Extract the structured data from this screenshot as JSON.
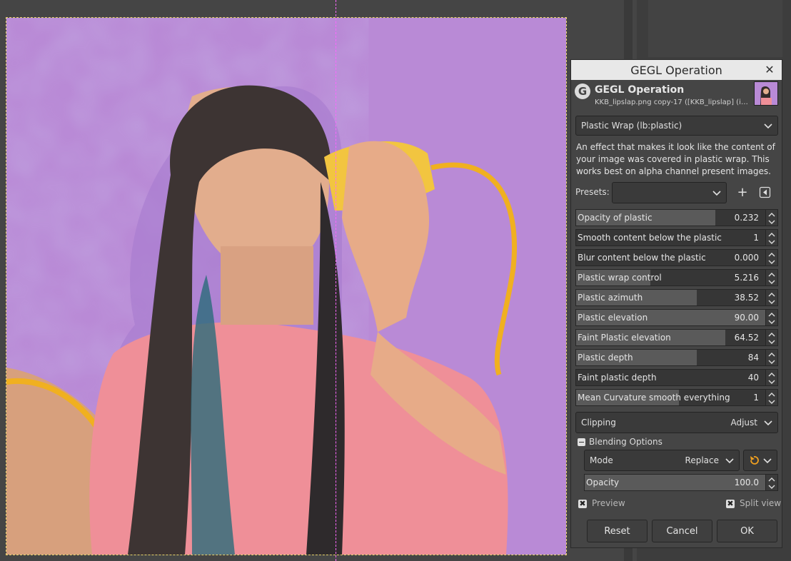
{
  "dialog": {
    "title": "GEGL Operation",
    "header_title": "GEGL Operation",
    "header_subtitle": "KKB_lipslap.png copy-17 ([KKB_lipslap] (imp...",
    "logo_letter": "G",
    "operation": "Plastic Wrap (lb:plastic)",
    "description": "An effect that makes it look like the content of your image was covered in plastic wrap. This works best on alpha channel present images.",
    "presets_label": "Presets:",
    "presets_value": "",
    "add_glyph": "+",
    "params": [
      {
        "label": "Opacity of plastic",
        "value": "0.232",
        "fill": 0.69
      },
      {
        "label": "Smooth content below the plastic",
        "value": "1",
        "fill": 0.0
      },
      {
        "label": "Blur content below the plastic",
        "value": "0.000",
        "fill": 0.0
      },
      {
        "label": "Plastic wrap control",
        "value": "5.216",
        "fill": 0.37
      },
      {
        "label": "Plastic azimuth",
        "value": "38.52",
        "fill": 0.6
      },
      {
        "label": "Plastic elevation",
        "value": "90.00",
        "fill": 1.0
      },
      {
        "label": "Faint Plastic elevation",
        "value": "64.52",
        "fill": 0.74
      },
      {
        "label": "Plastic depth",
        "value": "84",
        "fill": 0.6
      },
      {
        "label": "Faint plastic depth",
        "value": "40",
        "fill": 0.0
      },
      {
        "label": "Mean Curvature smooth everything",
        "value": "1",
        "fill": 0.51
      }
    ],
    "clipping_label": "Clipping",
    "clipping_value": "Adjust",
    "blending_label": "Blending Options",
    "mode_label": "Mode",
    "mode_value": "Replace",
    "opacity_label": "Opacity",
    "opacity_value": "100.0",
    "opacity_fill": 1.0,
    "preview_label": "Preview",
    "split_label": "Split view",
    "check_glyph": "✖",
    "buttons": {
      "reset": "Reset",
      "cancel": "Cancel",
      "ok": "OK"
    }
  },
  "colors": {
    "canvas_bg": "#454545",
    "image_bg": "#b98ad6",
    "split_guide": "#ff66ff"
  }
}
